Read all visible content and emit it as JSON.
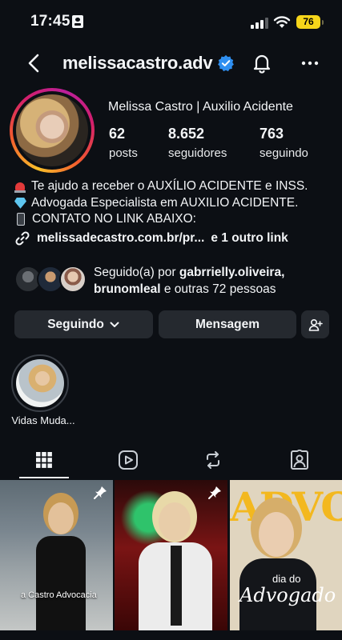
{
  "status_bar": {
    "time": "17:45",
    "battery": "76"
  },
  "header": {
    "username": "melissacastro.adv"
  },
  "profile": {
    "full_name": "Melissa Castro | Auxilio Acidente",
    "stats": [
      {
        "value": "62",
        "label": "posts"
      },
      {
        "value": "8.652",
        "label": "seguidores"
      },
      {
        "value": "763",
        "label": "seguindo"
      }
    ],
    "bio": [
      "Te ajudo a receber o AUXÍLIO ACIDENTE e INSS.",
      "Advogada Especialista em AUXILIO ACIDENTE.",
      "CONTATO NO LINK ABAIXO:"
    ],
    "link": {
      "url": "melissadecastro.com.br/pr...",
      "extra": "e 1 outro link"
    },
    "followed_by": {
      "prefix": "Seguido(a) por",
      "user1": "gabrrielly.oliveira,",
      "user2": "brunomleal",
      "suffix": "e outras 72 pessoas"
    }
  },
  "buttons": {
    "following": "Seguindo",
    "message": "Mensagem"
  },
  "highlights": [
    {
      "label": "Vidas Muda..."
    }
  ],
  "posts": [
    {
      "caption": "a Castro Advocacia"
    },
    {
      "caption": ""
    },
    {
      "big_text": "ADVO",
      "small_text": "dia do",
      "script_text": "Advogado"
    }
  ]
}
